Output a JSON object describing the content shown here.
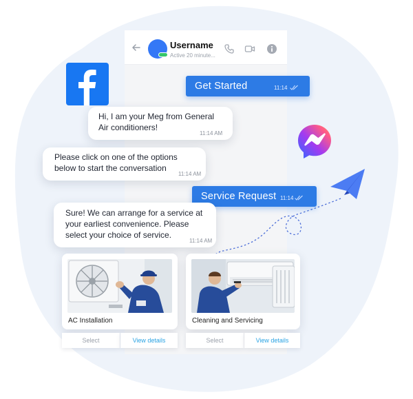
{
  "header": {
    "username": "Username",
    "status": "Active 20 minute...",
    "icons": [
      "back-arrow-icon",
      "phone-icon",
      "video-icon",
      "info-icon"
    ]
  },
  "messages": [
    {
      "id": "get-started",
      "direction": "out",
      "text": "Get Started",
      "time": "11:14"
    },
    {
      "id": "greeting",
      "direction": "in",
      "lines": [
        "Hi, I am your Meg from General",
        "Air conditioners!"
      ],
      "time": "11:14 AM"
    },
    {
      "id": "options-prompt",
      "direction": "in",
      "lines": [
        "Please click on one of the options",
        "below to start the conversation"
      ],
      "time": "11:14 AM"
    },
    {
      "id": "service-request",
      "direction": "out",
      "text": "Service Request",
      "time": "11:14"
    },
    {
      "id": "service-reply",
      "direction": "in",
      "lines": [
        "Sure! We can arrange for a service at",
        "your earliest convenience. Please",
        "select your choice of service."
      ],
      "time": "11:14 AM"
    }
  ],
  "cards": [
    {
      "title": "AC Installation",
      "select_label": "Select",
      "view_label": "View details"
    },
    {
      "title": "Cleaning and Servicing",
      "select_label": "Select",
      "view_label": "View details"
    }
  ],
  "colors": {
    "accent": "#2d7be5",
    "facebook": "#1877f2",
    "online": "#35c66b",
    "link": "#2aa3e3",
    "plane": "#3b6cf0",
    "blob": "#eef3fa"
  }
}
